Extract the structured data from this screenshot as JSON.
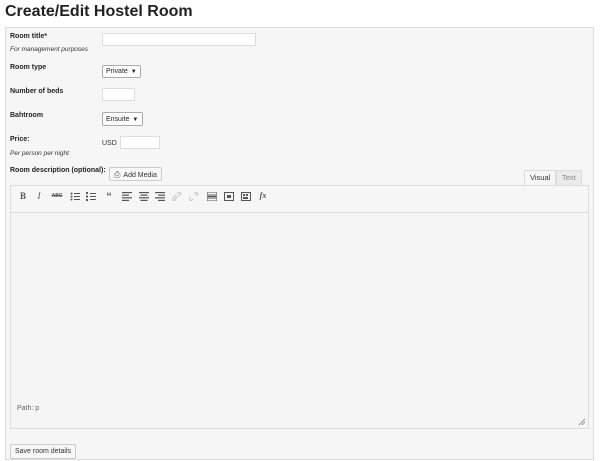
{
  "page": {
    "title": "Create/Edit Hostel Room"
  },
  "form": {
    "room_title": {
      "label": "Room title*",
      "hint": "For management purposes",
      "value": ""
    },
    "room_type": {
      "label": "Room type",
      "selected": "Private"
    },
    "beds": {
      "label": "Number of beds",
      "value": ""
    },
    "bathroom": {
      "label": "Bahtroom",
      "selected": "Ensuite"
    },
    "price": {
      "label": "Price:",
      "hint": "Per person per night",
      "currency": "USD",
      "value": ""
    },
    "description": {
      "label": "Room description (optional):"
    }
  },
  "media": {
    "add_label": "Add Media",
    "icon": "media-icon"
  },
  "editor": {
    "tabs": {
      "visual": "Visual",
      "text": "Text"
    },
    "toolbar": {
      "bold": "B",
      "italic": "I",
      "strike": "ABC",
      "quote": "“",
      "kitchen_sink": "fx"
    },
    "content": "",
    "status_path": "Path: p"
  },
  "actions": {
    "save_label": "Save room details"
  },
  "colors": {
    "panel_bg": "#f6f6f6",
    "border": "#dddddd",
    "disabled_icon": "#c8c8c8"
  }
}
